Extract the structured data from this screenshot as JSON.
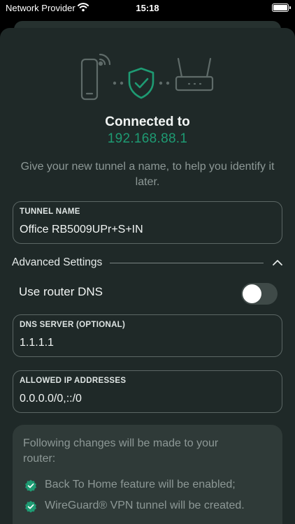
{
  "status_bar": {
    "provider": "Network Provider",
    "time": "15:18",
    "icons": [
      "wifi-icon",
      "battery-icon"
    ]
  },
  "connection": {
    "title": "Connected to",
    "ip": "192.168.88.1",
    "hint": "Give your new tunnel a name, to help you identify it later.",
    "illustration_icons": [
      "phone-icon",
      "shield-check-icon",
      "router-icon"
    ]
  },
  "tunnel_name": {
    "label": "TUNNEL NAME",
    "value": "Office RB5009UPr+S+IN"
  },
  "advanced": {
    "label": "Advanced Settings",
    "expanded": true,
    "use_router_dns": {
      "label": "Use router DNS",
      "enabled": false
    },
    "dns_server": {
      "label": "DNS SERVER (OPTIONAL)",
      "value": "1.1.1.1"
    },
    "allowed_ips": {
      "label": "ALLOWED IP ADDRESSES",
      "value": "0.0.0.0/0,::/0"
    }
  },
  "changes": {
    "intro": "Following changes will be made to your router:",
    "items": [
      "Back To Home feature will be enabled;",
      "WireGuard® VPN tunnel will be created."
    ]
  },
  "colors": {
    "background": "#1f2928",
    "accent_green": "#1e9b73",
    "muted_text": "#8d9896",
    "illustration": "#5f6b69"
  }
}
